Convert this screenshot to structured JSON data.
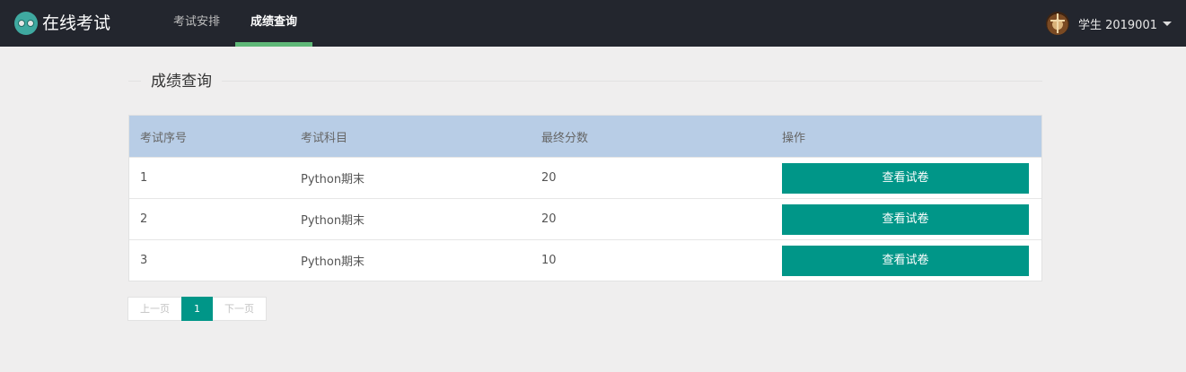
{
  "header": {
    "logo_text": "在线考试",
    "nav": [
      {
        "label": "考试安排",
        "active": false
      },
      {
        "label": "成绩查询",
        "active": true
      }
    ],
    "user_name": "学生 2019001"
  },
  "page": {
    "title": "成绩查询"
  },
  "table": {
    "columns": [
      "考试序号",
      "考试科目",
      "最终分数",
      "操作"
    ],
    "rows": [
      {
        "id": "1",
        "subject": "Python期末",
        "score": "20",
        "action": "查看试卷"
      },
      {
        "id": "2",
        "subject": "Python期末",
        "score": "20",
        "action": "查看试卷"
      },
      {
        "id": "3",
        "subject": "Python期末",
        "score": "10",
        "action": "查看试卷"
      }
    ]
  },
  "pagination": {
    "prev": "上一页",
    "current": "1",
    "next": "下一页"
  },
  "colors": {
    "header_bg": "#23262e",
    "accent": "#009688",
    "active_tab_bar": "#5fb878",
    "table_header_bg": "#b8cde6"
  }
}
